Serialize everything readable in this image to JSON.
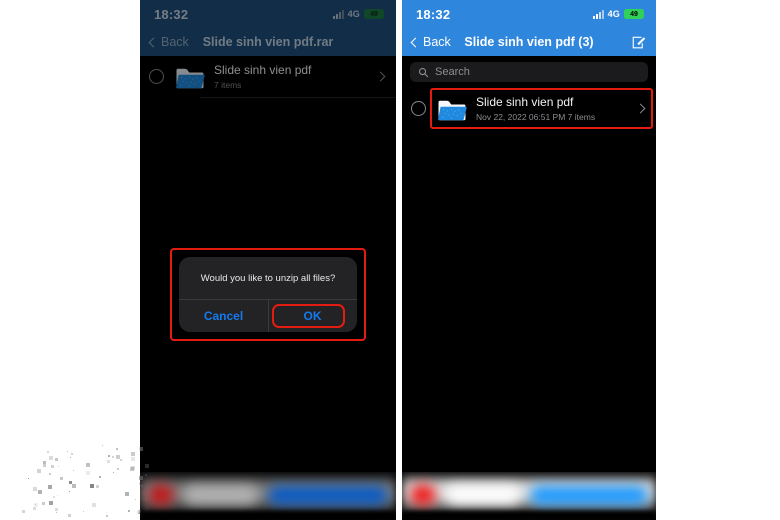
{
  "left_phone": {
    "status": {
      "time": "18:32",
      "network": "4G",
      "battery": "49",
      "signal_icon": "signal-bars-icon",
      "battery_icon": "battery-icon"
    },
    "nav": {
      "back_label": "Back",
      "back_icon": "chevron-left-icon",
      "title": "Slide sinh vien pdf.rar"
    },
    "row": {
      "title": "Slide sinh vien pdf",
      "subtitle": "7 items",
      "folder_icon": "folder-icon",
      "radio_icon": "radio-unchecked-icon",
      "chevron_icon": "chevron-right-icon"
    },
    "dialog": {
      "message": "Would you like to unzip all files?",
      "cancel_label": "Cancel",
      "ok_label": "OK"
    }
  },
  "right_phone": {
    "status": {
      "time": "18:32",
      "network": "4G",
      "battery": "49",
      "signal_icon": "signal-bars-icon",
      "battery_icon": "battery-icon"
    },
    "nav": {
      "back_label": "Back",
      "back_icon": "chevron-left-icon",
      "title": "Slide sinh vien pdf (3)",
      "action_icon": "compose-edit-icon"
    },
    "search": {
      "placeholder": "Search",
      "icon": "search-icon"
    },
    "row": {
      "title": "Slide sinh vien pdf",
      "subtitle": "Nov 22, 2022 06:51 PM  7 items",
      "folder_icon": "folder-icon",
      "radio_icon": "radio-unchecked-icon",
      "chevron_icon": "chevron-right-icon"
    }
  },
  "colors": {
    "page_background": "#ffffff",
    "header_blue_active": "#2f86dd",
    "header_blue_dimmed": "#1f4f7c",
    "screen_black": "#000000",
    "annotation_red": "#e41b11",
    "link_blue": "#1379ed",
    "battery_green": "#30d158",
    "folder_blue": "#1f8ae0"
  }
}
